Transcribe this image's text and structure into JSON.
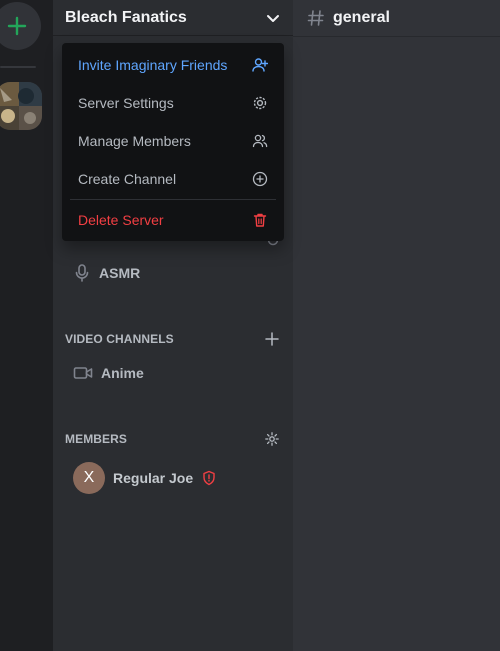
{
  "server": {
    "name": "Bleach Fanatics"
  },
  "menu": {
    "invite": "Invite Imaginary Friends",
    "settings": "Server Settings",
    "manage": "Manage Members",
    "create": "Create Channel",
    "delete": "Delete Server"
  },
  "channels": {
    "voice": [
      {
        "name": "ASMR"
      }
    ],
    "video_header": "VIDEO CHANNELS",
    "video": [
      {
        "name": "Anime"
      }
    ]
  },
  "members": {
    "header": "MEMBERS",
    "list": [
      {
        "initial": "X",
        "name": "Regular Joe"
      }
    ]
  },
  "main": {
    "channel_name": "general"
  },
  "colors": {
    "accent": "#5fa6ff",
    "danger": "#f23f43",
    "add": "#23a55a"
  }
}
